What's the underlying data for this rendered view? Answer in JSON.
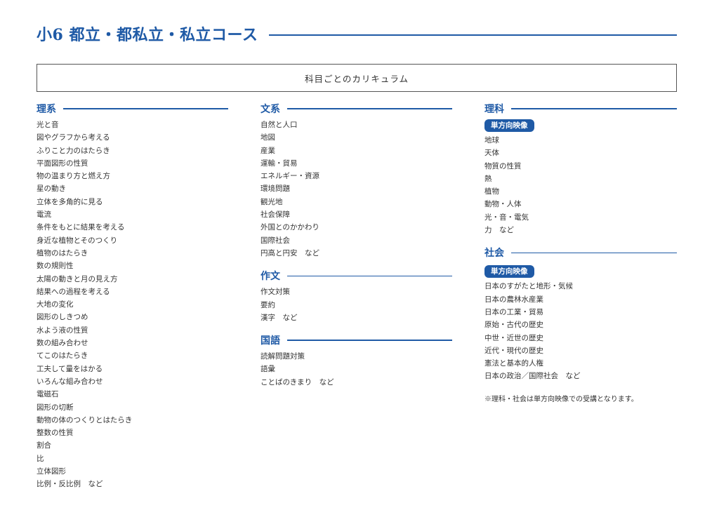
{
  "header": {
    "title": "小6 都立・都私立・私立コース"
  },
  "curriculum_label": "科目ごとのカリキュラム",
  "columns": {
    "science_math": {
      "title": "理系",
      "items": [
        "光と音",
        "図やグラフから考える",
        "ふりこと力のはたらき",
        "平面図形の性質",
        "物の温まり方と燃え方",
        "星の動き",
        "立体を多角的に見る",
        "電流",
        "条件をもとに結果を考える",
        "身近な植物とそのつくり",
        "植物のはたらき",
        "数の規則性",
        "太陽の動きと月の見え方",
        "結果への過程を考える",
        "大地の変化",
        "図形のしきつめ",
        "水よう液の性質",
        "数の組み合わせ",
        "てこのはたらき",
        "工夫して量をはかる",
        "いろんな組み合わせ",
        "電磁石",
        "図形の切断",
        "動物の体のつくりとはたらき",
        "整数の性質",
        "割合",
        "比",
        "立体図形",
        "比例・反比例　など"
      ]
    },
    "humanities": {
      "title": "文系",
      "items": [
        "自然と人口",
        "地図",
        "産業",
        "運輸・貿易",
        "エネルギー・資源",
        "環境問題",
        "観光地",
        "社会保障",
        "外国とのかかわり",
        "国際社会",
        "円高と円安　など"
      ]
    },
    "composition": {
      "title": "作文",
      "items": [
        "作文対策",
        "要約",
        "漢字　など"
      ]
    },
    "japanese": {
      "title": "国語",
      "items": [
        "読解問題対策",
        "語彙",
        "ことばのきまり　など"
      ]
    },
    "science": {
      "title": "理科",
      "badge": "単方向映像",
      "items": [
        "地球",
        "天体",
        "物質の性質",
        "熱",
        "植物",
        "動物・人体",
        "光・音・電気",
        "力　など"
      ]
    },
    "social": {
      "title": "社会",
      "badge": "単方向映像",
      "items": [
        "日本のすがたと地形・気候",
        "日本の農林水産業",
        "日本の工業・貿易",
        "原始・古代の歴史",
        "中世・近世の歴史",
        "近代・現代の歴史",
        "憲法と基本的人権",
        "日本の政治／国際社会　など"
      ]
    },
    "note": "※理科・社会は単方向映像での受講となります。"
  },
  "colors": {
    "accent": "#1f5aa6",
    "text": "#333333",
    "border": "#555555"
  }
}
